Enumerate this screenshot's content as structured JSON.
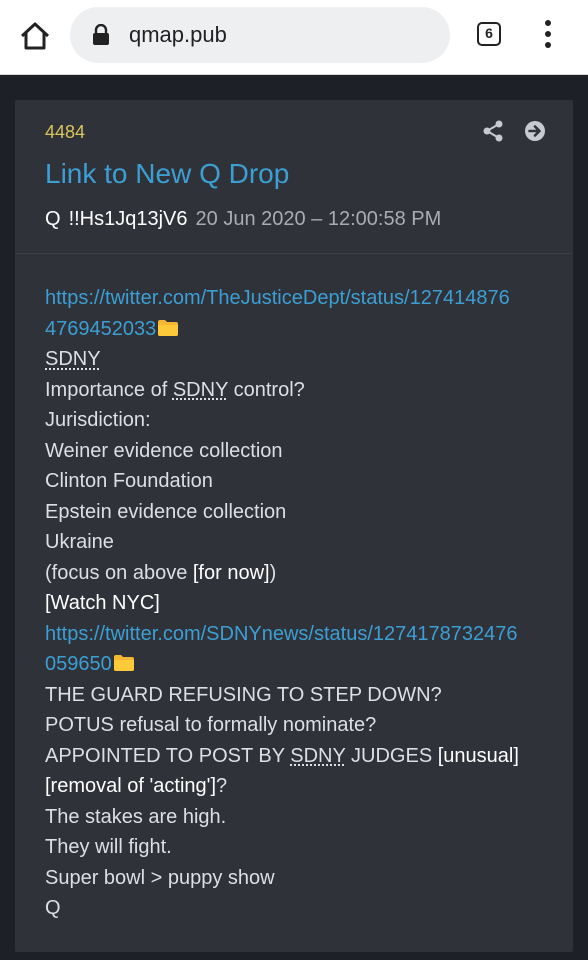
{
  "browser": {
    "url": "qmap.pub",
    "tab_count": "6"
  },
  "post": {
    "number": "4484",
    "title": "Link to New Q Drop",
    "author": "Q",
    "tripcode": "!!Hs1Jq13jV6",
    "date": "20 Jun 2020 – 12:00:58 PM",
    "link1_a": "https://twitter.com/TheJusticeDept/status/127414876",
    "link1_b": "4769452033",
    "sdny": "SDNY",
    "importance_pre": "Importance of ",
    "importance_post": " control?",
    "jurisdiction": "Jurisdiction:",
    "weiner": "Weiner evidence collection",
    "clinton": "Clinton Foundation",
    "epstein": "Epstein evidence collection",
    "ukraine": "Ukraine",
    "focus_pre": "(focus on above ",
    "focus_br": "[for now]",
    "focus_post": ")",
    "watch": "[Watch NYC]",
    "link2_a": "https://twitter.com/SDNYnews/status/1274178732476",
    "link2_b": "059650",
    "guard": "THE GUARD REFUSING TO STEP DOWN?",
    "potus": "POTUS refusal to formally nominate?",
    "appointed_pre": "APPOINTED TO POST BY ",
    "appointed_mid": " JUDGES ",
    "unusual": "[unusual]",
    "removal": "[removal of 'acting']",
    "removal_post": "?",
    "stakes": "The stakes are high.",
    "fight": "They will fight.",
    "superbowl": "Super bowl > puppy show",
    "sign": "Q"
  },
  "icons": {
    "home": "home-icon",
    "lock": "lock-icon",
    "menu": "more-vert-icon",
    "share": "share-icon",
    "goto": "arrow-right-circle-icon",
    "folder": "folder-icon"
  },
  "colors": {
    "link": "#3c9fd4",
    "post_number": "#d9c55a",
    "card_bg": "#2f3239",
    "page_bg": "#1d2026"
  }
}
